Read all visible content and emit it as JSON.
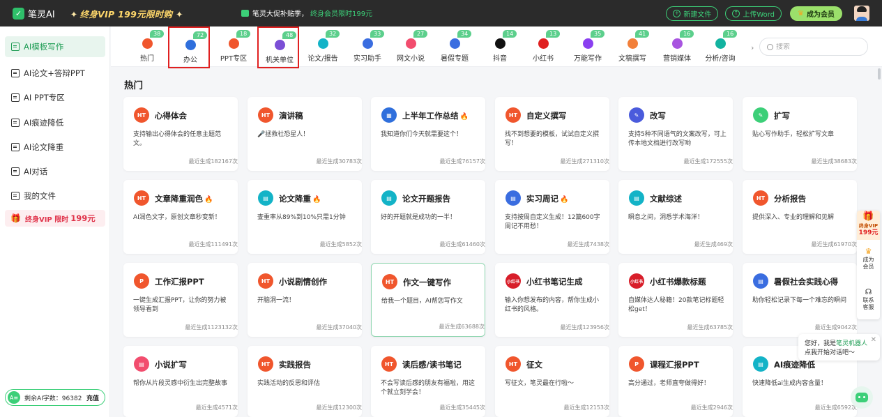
{
  "topbar": {
    "app_name": "笔灵AI",
    "vip_banner": "终身VIP 199元限时购",
    "promo_text": "笔灵大促补贴季，",
    "promo_highlight": "终身会员限时199元",
    "new_file": "新建文件",
    "upload_word": "上传Word",
    "member": "成为会员"
  },
  "sidebar": {
    "items": [
      {
        "label": "AI模板写作",
        "icon": "template-icon"
      },
      {
        "label": "AI论文+答辩PPT",
        "icon": "paper-icon"
      },
      {
        "label": "AI PPT专区",
        "icon": "ppt-icon"
      },
      {
        "label": "AI痕迹降低",
        "icon": "trace-icon"
      },
      {
        "label": "AI论文降重",
        "icon": "dedup-icon"
      },
      {
        "label": "AI对话",
        "icon": "chat-icon"
      },
      {
        "label": "我的文件",
        "icon": "file-icon"
      }
    ],
    "vip_promo": "终身VIP 限时",
    "vip_price": "199元",
    "quota_label": "剩余AI字数：96382",
    "recharge": "充值"
  },
  "categories": [
    {
      "label": "热门",
      "badge": "38",
      "color": "#f0562d"
    },
    {
      "label": "办公",
      "badge": "72",
      "color": "#2f6fdc"
    },
    {
      "label": "PPT专区",
      "badge": "18",
      "color": "#f0562d"
    },
    {
      "label": "机关单位",
      "badge": "48",
      "color": "#7b4fd6"
    },
    {
      "label": "论文/报告",
      "badge": "32",
      "color": "#13b3c7"
    },
    {
      "label": "实习助手",
      "badge": "33",
      "color": "#3a6de0"
    },
    {
      "label": "网文小说",
      "badge": "27",
      "color": "#f24d6e"
    },
    {
      "label": "暑假专题",
      "badge": "34",
      "color": "#3a6de0"
    },
    {
      "label": "抖音",
      "badge": "14",
      "color": "#111111"
    },
    {
      "label": "小红书",
      "badge": "13",
      "color": "#e02020"
    },
    {
      "label": "万能写作",
      "badge": "35",
      "color": "#8a3ff0"
    },
    {
      "label": "文稿撰写",
      "badge": "41",
      "color": "#f2803a"
    },
    {
      "label": "营销媒体",
      "badge": "16",
      "color": "#a855e0"
    },
    {
      "label": "分析/咨询",
      "badge": "16",
      "color": "#13b3a0"
    }
  ],
  "search": {
    "placeholder": "搜索"
  },
  "section_title": "热门",
  "cards": [
    {
      "title": "心得体会",
      "desc": "支持输出心得体会的任意主题范文。",
      "count": "最近生成182167次",
      "icon_text": "HT",
      "color": "#f0562d",
      "flame": ""
    },
    {
      "title": "演讲稿",
      "desc": "🎤拯救社恐星人！",
      "count": "最近生成30783次",
      "icon_text": "HT",
      "color": "#f0562d",
      "flame": ""
    },
    {
      "title": "上半年工作总结",
      "desc": "我知道你们今天就需要这个！",
      "count": "最近生成76157次",
      "icon_text": "▦",
      "color": "#2f6fdc",
      "flame": "🔥"
    },
    {
      "title": "自定义撰写",
      "desc": "找不到想要的模板，试试自定义撰写！",
      "count": "最近生成271310次",
      "icon_text": "HT",
      "color": "#f0562d",
      "flame": ""
    },
    {
      "title": "改写",
      "desc": "支持5种不同语气的文案改写，可上传本地文档进行改写哟",
      "count": "最近生成172555次",
      "icon_text": "✎",
      "color": "#4a5bdc",
      "flame": ""
    },
    {
      "title": "扩写",
      "desc": "贴心写作助手，轻松扩写文章",
      "count": "最近生成38683次",
      "icon_text": "✎",
      "color": "#3ccf78",
      "flame": ""
    },
    {
      "title": "文章降重润色",
      "desc": "AI润色文字，原创文章秒变新！",
      "count": "最近生成111491次",
      "icon_text": "HT",
      "color": "#f0562d",
      "flame": "🔥"
    },
    {
      "title": "论文降重",
      "desc": "查重率从89%到10%只需1分钟",
      "count": "最近生成5852次",
      "icon_text": "▤",
      "color": "#13b3c7",
      "flame": "🔥"
    },
    {
      "title": "论文开题报告",
      "desc": "好的开题就是成功的一半！",
      "count": "最近生成61460次",
      "icon_text": "▤",
      "color": "#13b3c7",
      "flame": ""
    },
    {
      "title": "实习周记",
      "desc": "支持按周自定义生成！12篇600字周记不用愁！",
      "count": "最近生成7438次",
      "icon_text": "▤",
      "color": "#3a6de0",
      "flame": "🔥"
    },
    {
      "title": "文献综述",
      "desc": "瞬息之间，洞悉学术海洋！",
      "count": "最近生成469次",
      "icon_text": "▤",
      "color": "#13b3c7",
      "flame": ""
    },
    {
      "title": "分析报告",
      "desc": "提供深入、专业的理解和见解",
      "count": "最近生成61970次",
      "icon_text": "HT",
      "color": "#f0562d",
      "flame": ""
    },
    {
      "title": "工作汇报PPT",
      "desc": "一键生成汇报PPT，让你的努力被领导看到",
      "count": "最近生成1123132次",
      "icon_text": "P",
      "color": "#f0562d",
      "flame": ""
    },
    {
      "title": "小说剧情创作",
      "desc": "开脑洞一流！",
      "count": "最近生成37040次",
      "icon_text": "HT",
      "color": "#f0562d",
      "flame": ""
    },
    {
      "title": "作文一键写作",
      "desc": "给我一个题目，AI帮您写作文",
      "count": "最近生成63688次",
      "icon_text": "HT",
      "color": "#f0562d",
      "flame": ""
    },
    {
      "title": "小红书笔记生成",
      "desc": "输入你想发布的内容，帮你生成小红书的风格。",
      "count": "最近生成123956次",
      "icon_text": "小红书",
      "color": "#d81e2a",
      "flame": ""
    },
    {
      "title": "小红书爆款标题",
      "desc": "自媒体达人秘籍！20款笔记标题轻松get！",
      "count": "最近生成63785次",
      "icon_text": "小红书",
      "color": "#d81e2a",
      "flame": ""
    },
    {
      "title": "暑假社会实践心得",
      "desc": "助你轻松记录下每一个难忘的瞬间",
      "count": "最近生成9042次",
      "icon_text": "▤",
      "color": "#3a6de0",
      "flame": ""
    },
    {
      "title": "小说扩写",
      "desc": "帮你从片段灵感中衍生出完整故事",
      "count": "最近生成4571次",
      "icon_text": "▤",
      "color": "#f24d6e",
      "flame": ""
    },
    {
      "title": "实践报告",
      "desc": "实践活动的反思和评估",
      "count": "最近生成12300次",
      "icon_text": "HT",
      "color": "#f0562d",
      "flame": ""
    },
    {
      "title": "读后感/读书笔记",
      "desc": "不会写读后感的朋友有福啦，用这个就立刻学会！",
      "count": "最近生成35445次",
      "icon_text": "HT",
      "color": "#f0562d",
      "flame": ""
    },
    {
      "title": "征文",
      "desc": "写征文，笔灵最在行啦～",
      "count": "最近生成12153次",
      "icon_text": "HT",
      "color": "#f0562d",
      "flame": ""
    },
    {
      "title": "课程汇报PPT",
      "desc": "高分通过，老师直夸做得好！",
      "count": "最近生成2946次",
      "icon_text": "P",
      "color": "#f0562d",
      "flame": ""
    },
    {
      "title": "AI痕迹降低",
      "desc": "快速降低ai生成内容含量！",
      "count": "最近生成6592次",
      "icon_text": "▤",
      "color": "#13b3c7",
      "flame": ""
    }
  ],
  "right_float": {
    "vip_t1": "终身VIP",
    "vip_t2": "199元",
    "member": "成为会员",
    "service": "联系客服"
  },
  "chat": {
    "greet": "您好，我是",
    "bot_name": "笔灵机器人",
    "prompt": "点我开始对话吧～"
  }
}
